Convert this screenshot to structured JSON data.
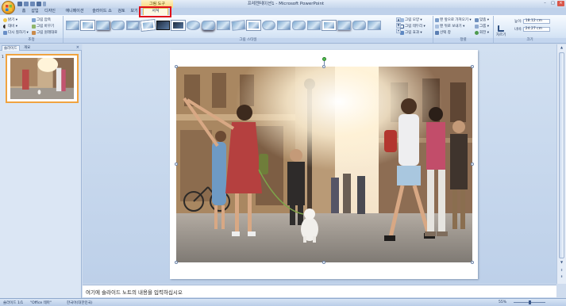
{
  "window": {
    "title": "프레젠테이션1 - Microsoft PowerPoint",
    "context_tab_group": "그림 도구",
    "controls": [
      "–",
      "□",
      "×"
    ]
  },
  "tabs": [
    {
      "label": "홈"
    },
    {
      "label": "삽입"
    },
    {
      "label": "디자인"
    },
    {
      "label": "애니메이션"
    },
    {
      "label": "슬라이드 쇼"
    },
    {
      "label": "검토"
    },
    {
      "label": "보기"
    },
    {
      "label": "서식",
      "active": true
    }
  ],
  "ribbon": {
    "adjust": {
      "label": "조정",
      "items": [
        "밝기 ▾",
        "대비 ▾",
        "다시 칠하기 ▾",
        "그림 압축",
        "그림 바꾸기",
        "그림 원래대로"
      ]
    },
    "picture_styles": {
      "label": "그림 스타일",
      "right_items": [
        "그림 모양 ▾",
        "그림 테두리 ▾",
        "그림 효과 ▾"
      ]
    },
    "arrange": {
      "label": "정렬",
      "items": [
        "맨 앞으로 가져오기 ▾",
        "맨 뒤로 보내기 ▾",
        "선택 창",
        "맞춤 ▾",
        "그룹 ▾",
        "회전 ▾"
      ]
    },
    "size": {
      "label": "크기",
      "crop": "자르기",
      "height_label": "높이:",
      "height_value": "18.12 cm",
      "width_label": "너비:",
      "width_value": "24.27 cm"
    }
  },
  "left_pane": {
    "tabs": [
      "슬라이드",
      "개요"
    ],
    "close": "×",
    "slide_number": "1"
  },
  "notes": {
    "placeholder": "여기에 슬라이드 노트의 내용을 입력하십시오"
  },
  "status_bar": {
    "slide_info": "슬라이드 1/1",
    "theme": "\"Office 테마\"",
    "language": "한국어(대한민국)",
    "zoom": "55%"
  },
  "colors": {
    "highlight_box": "#e0101a",
    "active_tab": "#fdf8e2",
    "ribbon_bg": "#dbe8f7"
  }
}
